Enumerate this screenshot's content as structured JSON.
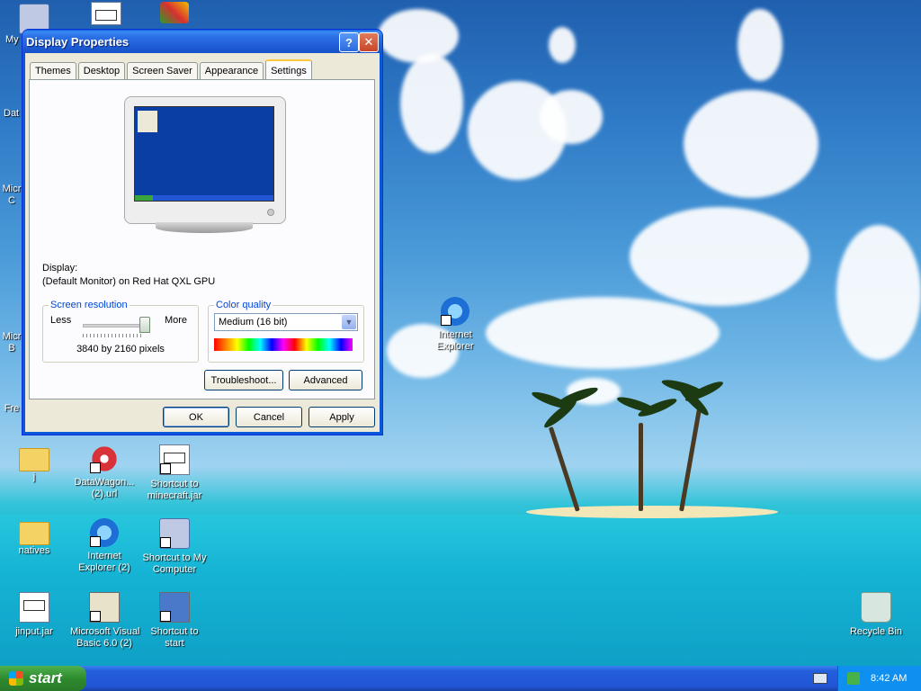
{
  "desktop": {
    "icons": [
      {
        "label": "My",
        "icon": "my-computer-icon"
      },
      {
        "label": "Dat",
        "icon": "jar-file-icon"
      },
      {
        "label": "Micr\nC",
        "icon": "ie-icon"
      },
      {
        "label": "Micr\nB",
        "icon": "vb-icon"
      },
      {
        "label": "Fre",
        "icon": "app-icon"
      },
      {
        "label": "j",
        "icon": "folder-icon"
      },
      {
        "label": "DataWagon...\n(2).url",
        "icon": "datawagon-icon"
      },
      {
        "label": "Shortcut to\nminecraft.jar",
        "icon": "jar-file-icon"
      },
      {
        "label": "natives",
        "icon": "folder-icon"
      },
      {
        "label": "Internet\nExplorer (2)",
        "icon": "ie-icon"
      },
      {
        "label": "Shortcut to My\nComputer",
        "icon": "my-computer-icon"
      },
      {
        "label": "jinput.jar",
        "icon": "jar-file-icon"
      },
      {
        "label": "Microsoft Visual\nBasic 6.0 (2)",
        "icon": "vb-icon"
      },
      {
        "label": "Shortcut to\nstart",
        "icon": "app-icon"
      },
      {
        "label": "Internet\nExplorer",
        "icon": "ie-icon"
      },
      {
        "label": "Recycle Bin",
        "icon": "recycle-bin-icon"
      }
    ]
  },
  "window": {
    "title": "Display Properties",
    "help_label": "?",
    "close_label": "✕",
    "tabs": [
      "Themes",
      "Desktop",
      "Screen Saver",
      "Appearance",
      "Settings"
    ],
    "active_tab": "Settings",
    "display_label": "Display:",
    "display_value": "(Default Monitor) on Red Hat QXL GPU",
    "screen_resolution": {
      "title": "Screen resolution",
      "less": "Less",
      "more": "More",
      "value": "3840 by 2160 pixels",
      "slider_position": 1.0
    },
    "color_quality": {
      "title": "Color quality",
      "selected": "Medium (16 bit)"
    },
    "buttons": {
      "troubleshoot": "Troubleshoot...",
      "advanced": "Advanced",
      "ok": "OK",
      "cancel": "Cancel",
      "apply": "Apply"
    }
  },
  "taskbar": {
    "start_label": "start",
    "clock": "8:42 AM"
  }
}
